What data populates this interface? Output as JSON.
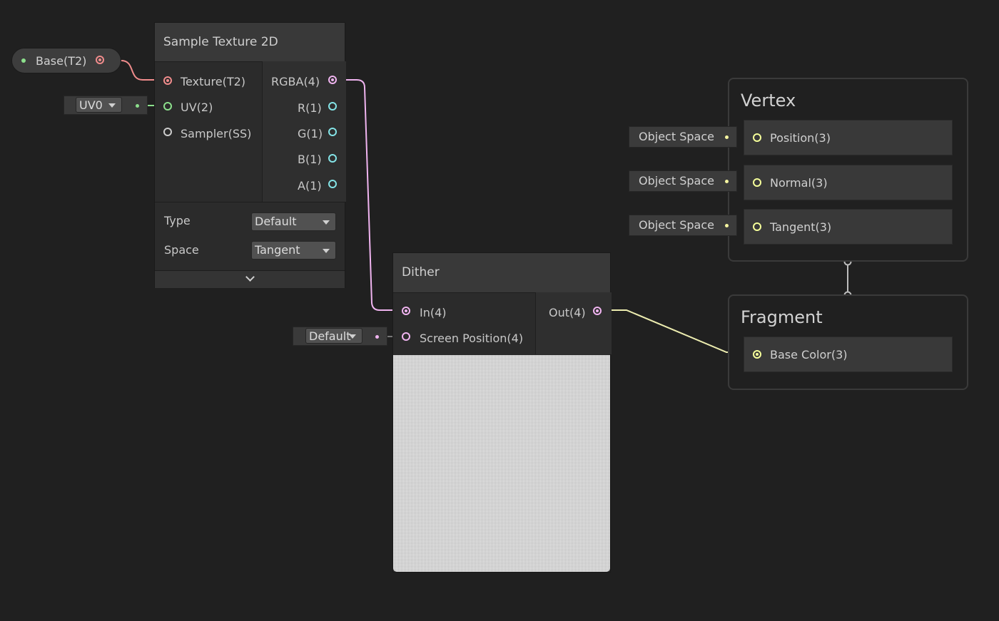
{
  "property_node": {
    "label": "Base(T2)"
  },
  "uv_input": {
    "value": "UV0"
  },
  "sample_texture": {
    "title": "Sample Texture 2D",
    "inputs": [
      "Texture(T2)",
      "UV(2)",
      "Sampler(SS)"
    ],
    "outputs": [
      "RGBA(4)",
      "R(1)",
      "G(1)",
      "B(1)",
      "A(1)"
    ],
    "type_label": "Type",
    "type_value": "Default",
    "space_label": "Space",
    "space_value": "Tangent"
  },
  "dither": {
    "title": "Dither",
    "inputs": [
      "In(4)",
      "Screen Position(4)"
    ],
    "output": "Out(4)",
    "screen_position_default": "Default"
  },
  "vertex": {
    "title": "Vertex",
    "slots": [
      {
        "label": "Position(3)",
        "space": "Object Space"
      },
      {
        "label": "Normal(3)",
        "space": "Object Space"
      },
      {
        "label": "Tangent(3)",
        "space": "Object Space"
      }
    ]
  },
  "fragment": {
    "title": "Fragment",
    "slots": [
      {
        "label": "Base Color(3)"
      }
    ]
  },
  "colors": {
    "texture_port": "#f08c8c",
    "uv_port": "#8ce08c",
    "vector4_port": "#f0b4f0",
    "vector1_port": "#84e4e7",
    "vector3_port": "#f6ff9a",
    "sampler_port": "#cccccc"
  }
}
